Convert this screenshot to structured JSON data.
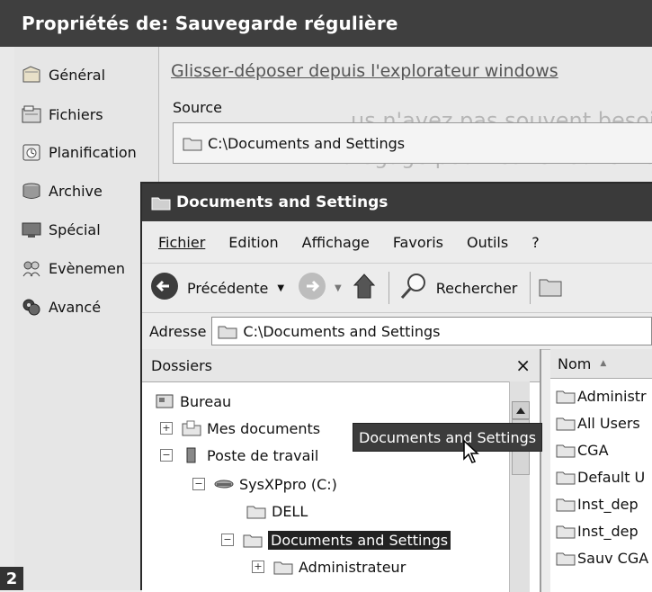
{
  "background": {
    "ghost_line1": "us n'avez pas souvent besoin, toujours à l'aide",
    "ghost_line2": "alogage pour les retrouver rapidement.",
    "page_number": "2"
  },
  "properties": {
    "title": "Propriétés de: Sauvegarde régulière",
    "sidebar": [
      {
        "label": "Général",
        "icon": "general-icon"
      },
      {
        "label": "Fichiers",
        "icon": "files-icon"
      },
      {
        "label": "Planification",
        "icon": "clock-icon"
      },
      {
        "label": "Archive",
        "icon": "archive-icon"
      },
      {
        "label": "Spécial",
        "icon": "monitor-icon"
      },
      {
        "label": "Evènemen",
        "icon": "events-icon"
      },
      {
        "label": "Avancé",
        "icon": "advanced-icon"
      }
    ],
    "main": {
      "heading": "Glisser-déposer depuis l'explorateur windows",
      "source_label": "Source",
      "source_path": "C:\\Documents and Settings"
    }
  },
  "explorer": {
    "title": "Documents and Settings",
    "menu": [
      "Fichier",
      "Edition",
      "Affichage",
      "Favoris",
      "Outils",
      "?"
    ],
    "toolbar": {
      "back_label": "Précédente",
      "search_label": "Rechercher"
    },
    "address": {
      "label": "Adresse",
      "value": "C:\\Documents and Settings"
    },
    "folders": {
      "title": "Dossiers",
      "close": "×",
      "tree": [
        {
          "label": "Bureau",
          "level": 0,
          "expander": ""
        },
        {
          "label": "Mes documents",
          "level": 1,
          "expander": "+"
        },
        {
          "label": "Poste de travail",
          "level": 1,
          "expander": "−"
        },
        {
          "label": "SysXPpro (C:)",
          "level": 2,
          "expander": "−"
        },
        {
          "label": "DELL",
          "level": 3,
          "expander": ""
        },
        {
          "label": "Documents and Settings",
          "level": 3,
          "expander": "−",
          "selected": true
        },
        {
          "label": "Administrateur",
          "level": 4,
          "expander": "+"
        }
      ]
    },
    "list": {
      "column": "Nom",
      "sort_indicator": "▲",
      "items": [
        "Administr",
        "All Users",
        "CGA",
        "Default U",
        "Inst_dep",
        "Inst_dep",
        "Sauv CGA"
      ]
    },
    "tooltip": "Documents and Settings"
  },
  "colors": {
    "titlebar": "#3f3f3f",
    "selection": "#222222"
  }
}
